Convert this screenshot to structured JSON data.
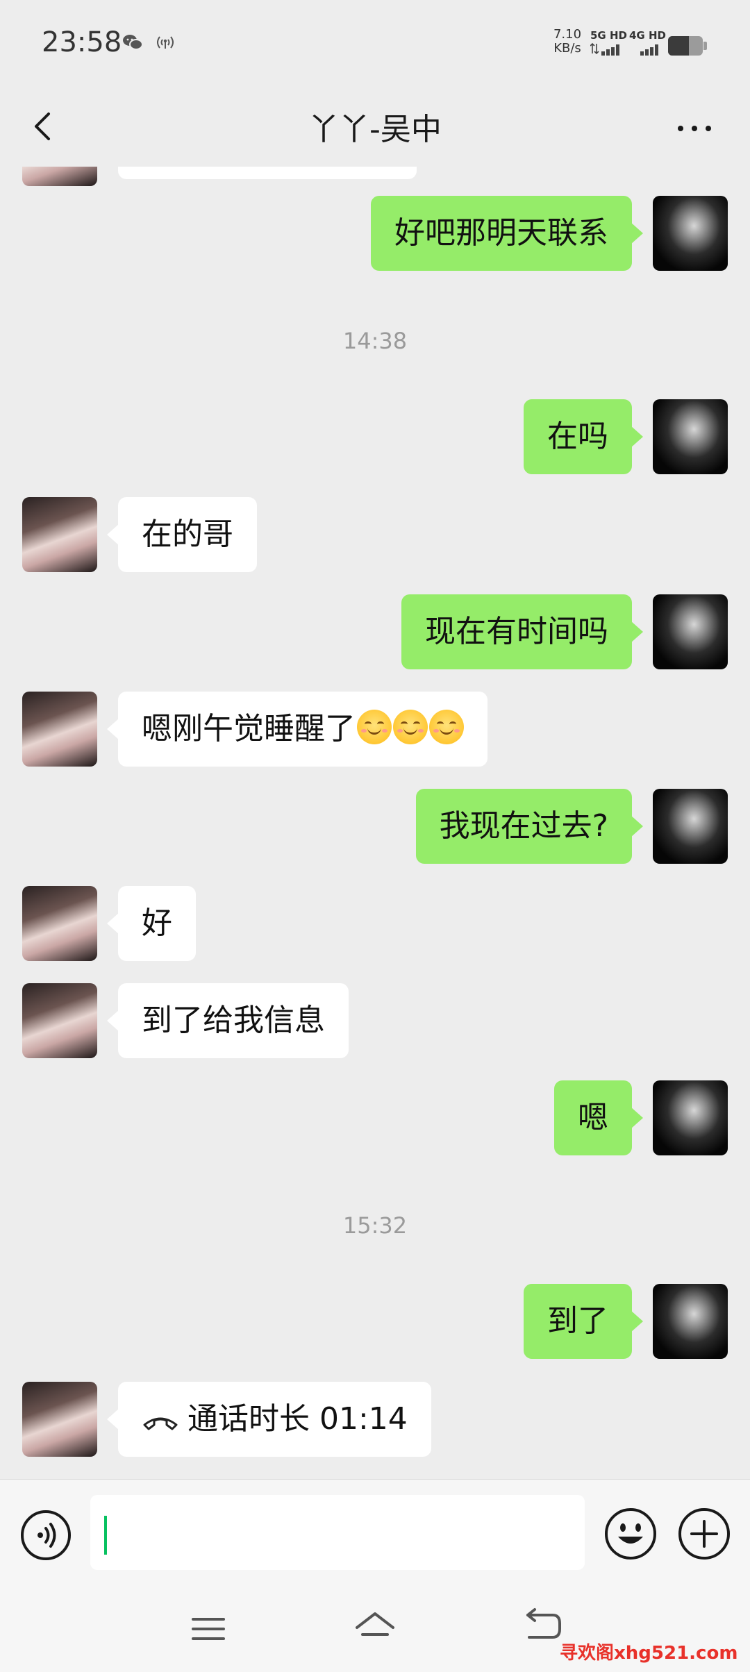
{
  "status_bar": {
    "time": "23:58",
    "net_speed_value": "7.10",
    "net_speed_unit": "KB/s",
    "sim1_label": "5G HD",
    "sim2_label": "4G HD",
    "battery_level": 0.6,
    "icons": [
      "wechat-icon",
      "hotspot-icon",
      "signal-icon",
      "battery-icon"
    ]
  },
  "header": {
    "title": "丫丫-吴中",
    "icons": [
      "back-icon",
      "more-icon"
    ]
  },
  "timestamps": [
    "14:38",
    "15:32"
  ],
  "messages": [
    {
      "from": "me",
      "text": "好吧那明天联系"
    },
    {
      "from": "me",
      "text": "在吗"
    },
    {
      "from": "her",
      "text": "在的哥"
    },
    {
      "from": "me",
      "text": "现在有时间吗"
    },
    {
      "from": "her",
      "text": "嗯刚午觉睡醒了",
      "emoji": [
        "smiling-face-emoji",
        "smiling-face-emoji",
        "smiling-face-emoji"
      ]
    },
    {
      "from": "me",
      "text": "我现在过去?"
    },
    {
      "from": "her",
      "text": "好"
    },
    {
      "from": "her",
      "text": "到了给我信息"
    },
    {
      "from": "me",
      "text": "嗯"
    },
    {
      "from": "me",
      "text": "到了"
    },
    {
      "from": "her",
      "text": "通话时长 01:14",
      "icon": "phone-hangup-icon"
    }
  ],
  "input_bar": {
    "value": "",
    "icons": [
      "voice-icon",
      "emoji-icon",
      "plus-icon"
    ]
  },
  "system_nav": {
    "icons": [
      "menu-icon",
      "home-icon",
      "back-nav-icon"
    ]
  },
  "watermark": "寻欢阁xhg521.com",
  "colors": {
    "background": "#ededed",
    "my_bubble": "#95ec69",
    "her_bubble": "#ffffff",
    "caret": "#07c160",
    "watermark": "#e8312a"
  }
}
